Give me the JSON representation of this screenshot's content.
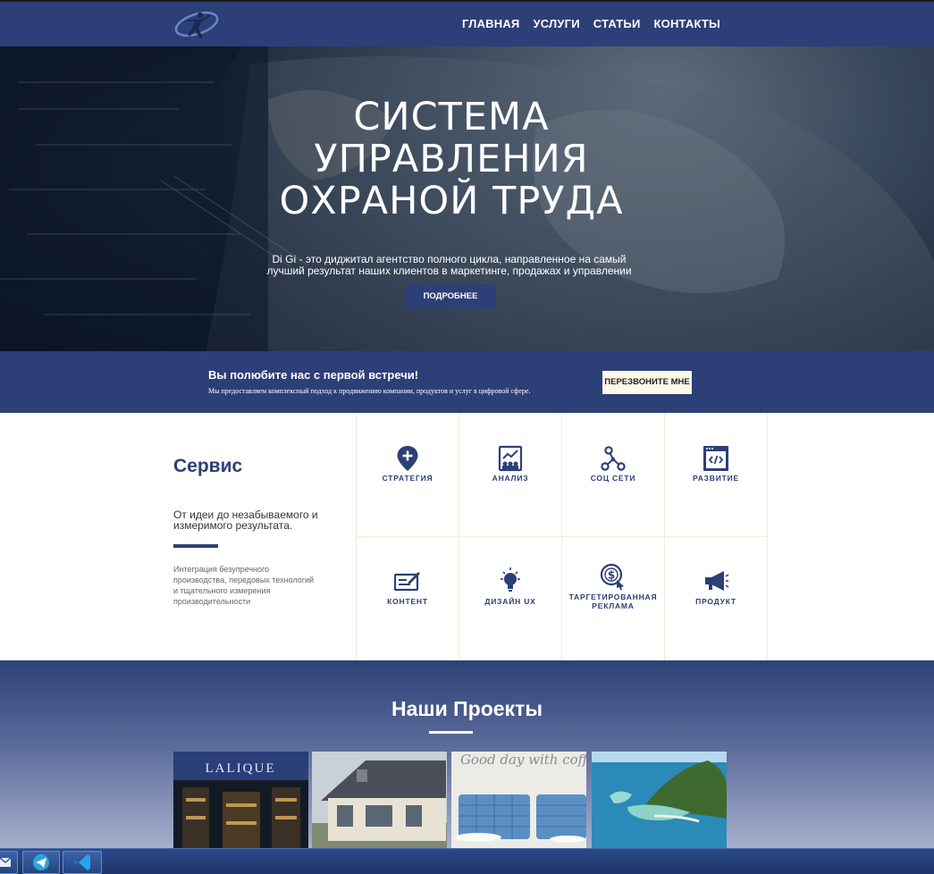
{
  "header": {
    "logo": "logo-icon",
    "nav": [
      "ГЛАВНАЯ",
      "УСЛУГИ",
      "СТАТЬИ",
      "КОНТАКТЫ"
    ]
  },
  "hero": {
    "title_lines": [
      "СИСТЕМА",
      "УПРАВЛЕНИЯ",
      "ОХРАНОЙ ТРУДА"
    ],
    "description": "Di Gi - это диджитал агентство полного цикла, направленное на самый лучший результат наших клиентов в маркетинге, продажах и управлении",
    "button": "ПОДРОБНЕЕ"
  },
  "callback": {
    "title": "Вы полюбите нас с первой встречи!",
    "subtitle": "Мы предоставляем комплексный подход к продвижению компании, продуктов и услуг в цифровой сфере.",
    "button": "ПЕРЕЗВОНИТЕ МНЕ"
  },
  "services": {
    "title": "Сервис",
    "subtitle": "От идеи до незабываемого и измеримого результата.",
    "description": "Интеграция безупречного производства, передовых технологий и тщательного измерения производительности",
    "items": [
      {
        "label": "СТРАТЕГИЯ",
        "icon": "location-pin-plus-icon"
      },
      {
        "label": "АНАЛИЗ",
        "icon": "analytics-chart-icon"
      },
      {
        "label": "СОЦ СЕТИ",
        "icon": "network-nodes-icon"
      },
      {
        "label": "РАЗВИТИЕ",
        "icon": "code-window-icon"
      },
      {
        "label": "КОНТЕНТ",
        "icon": "edit-content-icon"
      },
      {
        "label": "ДИЗАЙН UX",
        "icon": "lightbulb-icon"
      },
      {
        "label": "ТАРГЕТИРОВАННАЯ РЕКЛАМА",
        "icon": "dollar-target-icon"
      },
      {
        "label": "ПРОДУКТ",
        "icon": "megaphone-icon"
      }
    ]
  },
  "projects": {
    "title": "Наши Проекты",
    "images": [
      {
        "icon": "lalique-store-image",
        "sign": "LALIQUE"
      },
      {
        "icon": "house-image"
      },
      {
        "icon": "cafe-image",
        "sign": "Good day with coffee"
      },
      {
        "icon": "island-aerial-image"
      }
    ]
  },
  "colors": {
    "brand": "#2c3f77",
    "callback_button_bg": "#fdf8e8",
    "grid_border": "#f1ebd9"
  }
}
